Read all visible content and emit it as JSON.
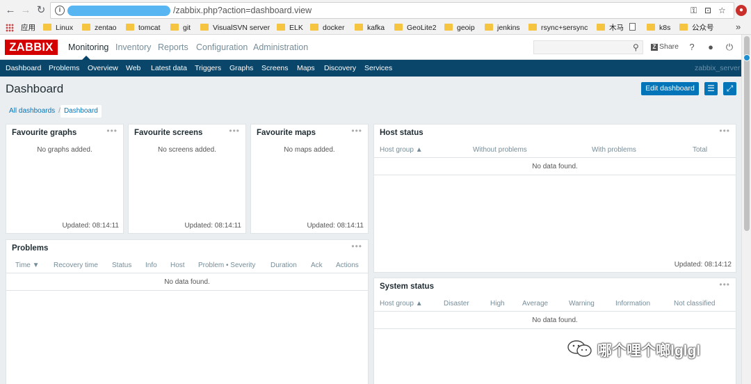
{
  "browser": {
    "url_path": "/zabbix.php?action=dashboard.view",
    "bookmarks": [
      "应用",
      "Linux",
      "zentao",
      "tomcat",
      "git",
      "VisualSVN server",
      "ELK",
      "docker",
      "kafka",
      "GeoLite2",
      "geoip",
      "jenkins",
      "rsync+sersync",
      "木马",
      "k8s",
      "公众号"
    ],
    "more": "»"
  },
  "header": {
    "logo": "ZABBIX",
    "menu": [
      "Monitoring",
      "Inventory",
      "Reports",
      "Configuration",
      "Administration"
    ],
    "active_menu": "Monitoring",
    "share_label": "Share",
    "help_label": "?"
  },
  "subnav": {
    "items": [
      "Dashboard",
      "Problems",
      "Overview",
      "Web",
      "Latest data",
      "Triggers",
      "Graphs",
      "Screens",
      "Maps",
      "Discovery",
      "Services"
    ],
    "server_name": "zabbix_server"
  },
  "page": {
    "title": "Dashboard",
    "edit_button": "Edit dashboard",
    "breadcrumb_root": "All dashboards",
    "breadcrumb_sep": "/",
    "breadcrumb_current": "Dashboard"
  },
  "widgets": {
    "menu_glyph": "•••",
    "fav_graphs": {
      "title": "Favourite graphs",
      "message": "No graphs added.",
      "updated": "Updated: 08:14:11"
    },
    "fav_screens": {
      "title": "Favourite screens",
      "message": "No screens added.",
      "updated": "Updated: 08:14:11"
    },
    "fav_maps": {
      "title": "Favourite maps",
      "message": "No maps added.",
      "updated": "Updated: 08:14:11"
    },
    "host_status": {
      "title": "Host status",
      "columns": [
        "Host group ▲",
        "Without problems",
        "With problems",
        "Total"
      ],
      "nodata": "No data found.",
      "updated": "Updated: 08:14:12"
    },
    "problems": {
      "title": "Problems",
      "columns": [
        "Time ▼",
        "Recovery time",
        "Status",
        "Info",
        "Host",
        "Problem • Severity",
        "Duration",
        "Ack",
        "Actions"
      ],
      "nodata": "No data found."
    },
    "system_status": {
      "title": "System status",
      "columns": [
        "Host group ▲",
        "Disaster",
        "High",
        "Average",
        "Warning",
        "Information",
        "Not classified"
      ],
      "nodata": "No data found."
    }
  },
  "watermark": {
    "text": "哪个哩个啷lglgl"
  },
  "colors": {
    "brand": "#d40000",
    "nav": "#0a466a",
    "accent": "#0275b8"
  }
}
